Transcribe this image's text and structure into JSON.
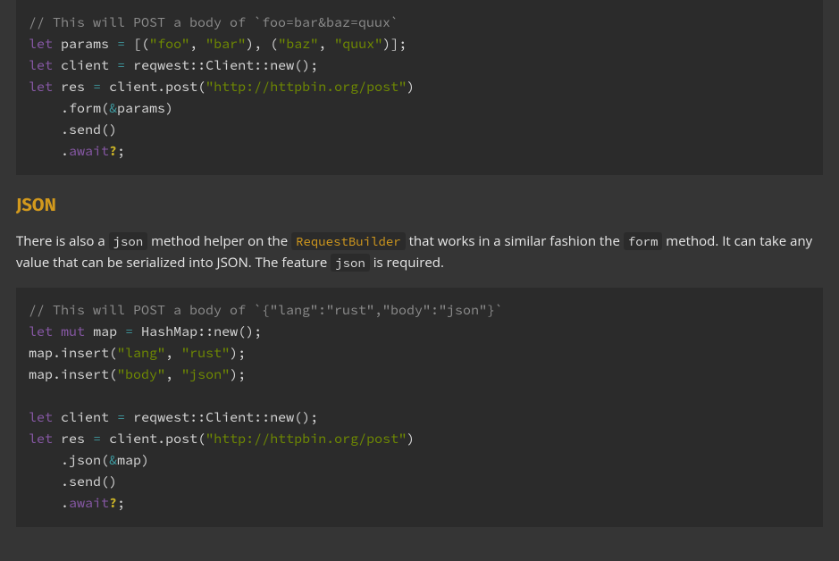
{
  "code1": {
    "comment": "// This will POST a body of `foo=bar&baz=quux`",
    "kw_let1": "let",
    "id_params": "params",
    "eq": "=",
    "lbracket": "[(",
    "str_foo": "\"foo\"",
    "comma": ",",
    "str_bar": "\"bar\"",
    "mid": "), (",
    "str_baz": "\"baz\"",
    "str_quux": "\"quux\"",
    "rbracket": ")];",
    "kw_let2": "let",
    "id_client": "client",
    "clientnew": "reqwest::Client::new();",
    "kw_let3": "let",
    "id_res": "res",
    "clientpost": "client.post(",
    "url": "\"http://httpbin.org/post\"",
    "rparen": ")",
    "formline_pre": "    .form(",
    "amp": "&",
    "form_param": "params",
    "formline_post": ")",
    "sendline": "    .send()",
    "awaitline_pre": "    .",
    "kw_await": "await",
    "q": "?",
    "semi": ";"
  },
  "heading": "JSON",
  "prose": {
    "p1a": "There is also a ",
    "c_json": "json",
    "p1b": " method helper on the ",
    "link_rb": "RequestBuilder",
    "p1c": " that works in a similar fashion the ",
    "c_form": "form",
    "p1d": " method. It can take any value that can be serialized into JSON. The feature ",
    "c_jsonfeat": "json",
    "p1e": " is required."
  },
  "code2": {
    "comment": "// This will POST a body of `{\"lang\":\"rust\",\"body\":\"json\"}`",
    "kw_let1": "let",
    "kw_mut": "mut",
    "id_map": "map",
    "eq": "=",
    "hashnew": "HashMap::new();",
    "ins1_pre": "map.insert(",
    "str_lang": "\"lang\"",
    "comma": ",",
    "str_rust": "\"rust\"",
    "ins_post": ");",
    "ins2_pre": "map.insert(",
    "str_body": "\"body\"",
    "str_json": "\"json\"",
    "kw_let2": "let",
    "id_client": "client",
    "clientnew": "reqwest::Client::new();",
    "kw_let3": "let",
    "id_res": "res",
    "clientpost": "client.post(",
    "url": "\"http://httpbin.org/post\"",
    "rparen": ")",
    "jsonline_pre": "    .json(",
    "amp": "&",
    "json_param": "map",
    "jsonline_post": ")",
    "sendline": "    .send()",
    "awaitline_pre": "    .",
    "kw_await": "await",
    "q": "?",
    "semi": ";"
  }
}
